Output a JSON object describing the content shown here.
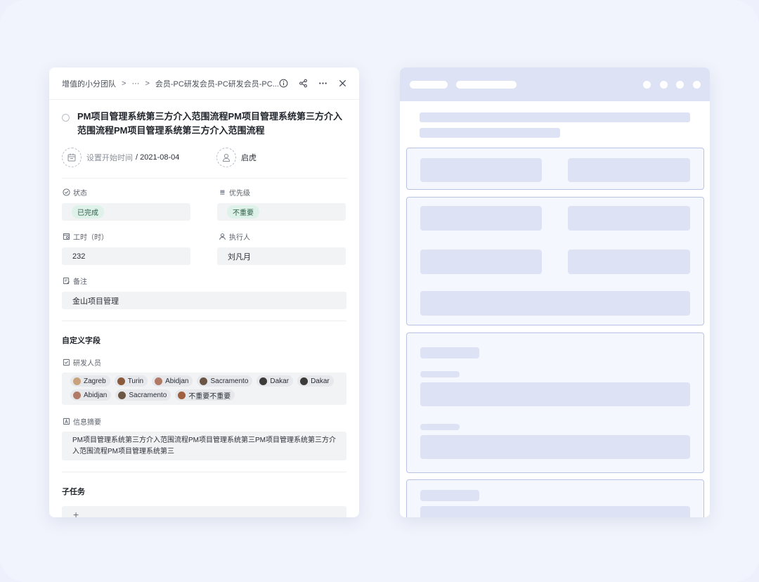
{
  "breadcrumb": {
    "items": [
      "增值的小分团队",
      "···",
      "会员-PC研发会员-PC研发会员-PC..."
    ],
    "separator": ">"
  },
  "header_icons": [
    "info-icon",
    "share-icon",
    "more-icon",
    "close-icon"
  ],
  "task": {
    "title": "PM项目管理系统第三方介入范围流程PM项目管理系统第三方介入范围流程PM项目管理系统第三方介入范围流程",
    "start_placeholder": "设置开始时间",
    "start_date": "/ 2021-08-04",
    "owner": "启虎"
  },
  "fields": {
    "status": {
      "label": "状态",
      "value": "已完成",
      "color": "#dff2e9"
    },
    "priority": {
      "label": "优先级",
      "value": "不重要",
      "color": "#dff2e9"
    },
    "hours": {
      "label": "工时（时）",
      "value": "232"
    },
    "assignee": {
      "label": "执行人",
      "value": "刘凡月"
    },
    "note": {
      "label": "备注",
      "value": "金山项目管理"
    }
  },
  "custom": {
    "section_title": "自定义字段",
    "developers_label": "研发人员",
    "developers": [
      {
        "name": "Zagreb",
        "color": "#c8a27a"
      },
      {
        "name": "Turin",
        "color": "#8a5a3c"
      },
      {
        "name": "Abidjan",
        "color": "#b07a66"
      },
      {
        "name": "Sacramento",
        "color": "#6b5544"
      },
      {
        "name": "Dakar",
        "color": "#3d3a3a"
      },
      {
        "name": "Dakar",
        "color": "#3d3a3a"
      },
      {
        "name": "Abidjan",
        "color": "#b07a66"
      },
      {
        "name": "Sacramento",
        "color": "#6b5544"
      },
      {
        "name": "不重要不重要",
        "color": "#a0603f"
      }
    ],
    "summary_label": "信息摘要",
    "summary": "PM项目管理系统第三方介入范围流程PM项目管理系统第三PM项目管理系统第三方介入范围流程PM项目管理系统第三"
  },
  "subtasks": {
    "title": "子任务",
    "add_label": "+"
  },
  "colors": {
    "wire_header": "#dde2f5",
    "wire_border": "#b9c3e6",
    "pill_green": "#dff2e9"
  }
}
